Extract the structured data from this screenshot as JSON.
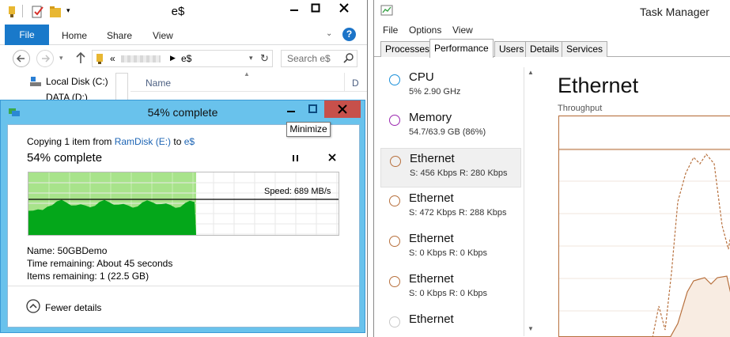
{
  "explorer": {
    "title": "e$",
    "ribbon": {
      "file": "File",
      "tabs": [
        "Home",
        "Share",
        "View"
      ]
    },
    "address": {
      "prefix": "«",
      "current": "e$"
    },
    "search_placeholder": "Search e$",
    "nav": {
      "local_disk": "Local Disk (C:)",
      "data": "DATA (D:)"
    },
    "column_name": "Name",
    "column_d": "D"
  },
  "copy_dialog": {
    "title": "54% complete",
    "copying_prefix": "Copying 1 item from ",
    "source": "RamDisk (E:)",
    "to_word": " to ",
    "destination": "e$",
    "percent_label": "54% complete",
    "speed": "Speed: 689 MB/s",
    "progress_fraction": 0.54,
    "name_line": "Name:  50GBDemo",
    "time_line": "Time remaining:  About 45 seconds",
    "items_line": "Items remaining:  1 (22.5 GB)",
    "fewer_details": "Fewer details",
    "tooltip": "Minimize",
    "colors": {
      "frame": "#69c2ec",
      "fill": "#04a71a",
      "bg_fill": "#a8e38b",
      "close": "#c7504b"
    }
  },
  "task_manager": {
    "title": "Task Manager",
    "menu": [
      "File",
      "Options",
      "View"
    ],
    "tabs": [
      "Processes",
      "Performance",
      "Users",
      "Details",
      "Services"
    ],
    "active_tab": "Performance",
    "items": [
      {
        "name": "CPU",
        "sub": "5%  2.90 GHz",
        "color": "#1a8fd9"
      },
      {
        "name": "Memory",
        "sub": "54.7/63.9 GB (86%)",
        "color": "#9b27b0"
      },
      {
        "name": "Ethernet",
        "sub": "S: 456 Kbps  R: 280 Kbps",
        "color": "#b7703d"
      },
      {
        "name": "Ethernet",
        "sub": "S: 472 Kbps  R: 288 Kbps",
        "color": "#b7703d"
      },
      {
        "name": "Ethernet",
        "sub": "S: 0 Kbps  R: 0 Kbps",
        "color": "#b7703d"
      },
      {
        "name": "Ethernet",
        "sub": "S: 0 Kbps  R: 0 Kbps",
        "color": "#b7703d"
      },
      {
        "name": "Ethernet",
        "sub": "",
        "color": "#c8c8c8"
      }
    ],
    "heading": "Ethernet",
    "throughput": "Throughput"
  }
}
